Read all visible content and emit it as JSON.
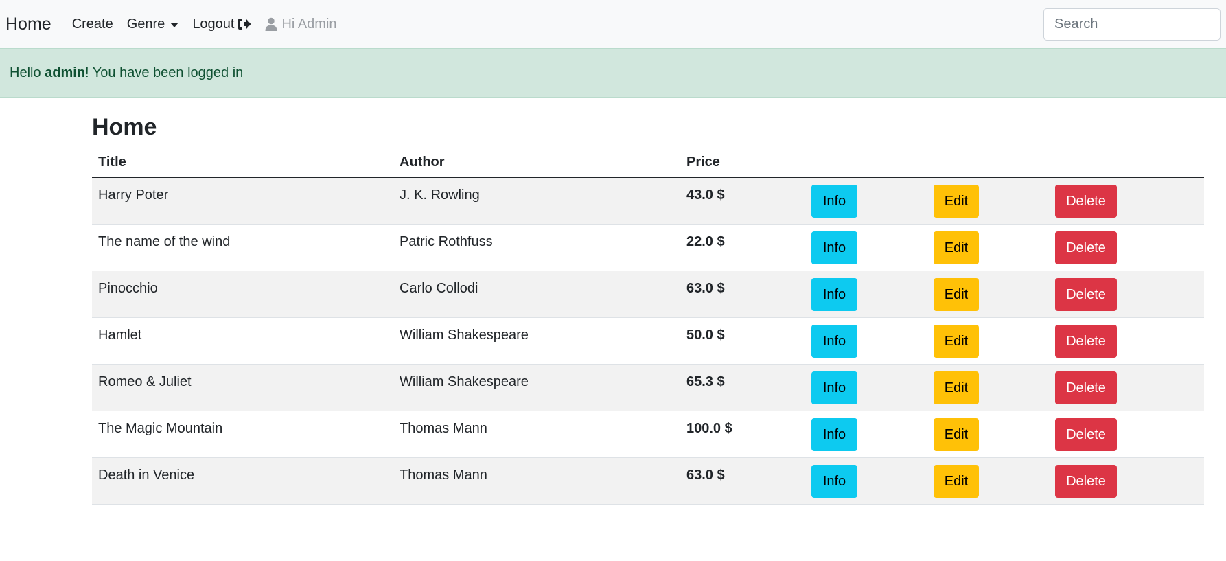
{
  "navbar": {
    "brand": "Home",
    "links": {
      "create": "Create",
      "genre": "Genre",
      "logout": "Logout",
      "user": "Hi Admin"
    },
    "search_placeholder": "Search",
    "icons": {
      "genre": "caret-down-icon",
      "logout": "sign-out-icon",
      "user": "user-icon"
    }
  },
  "alert": {
    "prefix": "Hello ",
    "username": "admin",
    "suffix": "! You have been logged in"
  },
  "main": {
    "title": "Home",
    "columns": {
      "title": "Title",
      "author": "Author",
      "price": "Price"
    },
    "buttons": {
      "info": "Info",
      "edit": "Edit",
      "delete": "Delete"
    },
    "rows": [
      {
        "title": "Harry Poter",
        "author": "J. K. Rowling",
        "price": "43.0 $"
      },
      {
        "title": "The name of the wind",
        "author": "Patric Rothfuss",
        "price": "22.0 $"
      },
      {
        "title": "Pinocchio",
        "author": "Carlo Collodi",
        "price": "63.0 $"
      },
      {
        "title": "Hamlet",
        "author": "William Shakespeare",
        "price": "50.0 $"
      },
      {
        "title": "Romeo & Juliet",
        "author": "William Shakespeare",
        "price": "65.3 $"
      },
      {
        "title": "The Magic Mountain",
        "author": "Thomas Mann",
        "price": "100.0 $"
      },
      {
        "title": "Death in Venice",
        "author": "Thomas Mann",
        "price": "63.0 $"
      }
    ]
  },
  "colors": {
    "navbar_bg": "#f8f9fa",
    "alert_bg": "#d1e7dd",
    "alert_text": "#0f5132",
    "info": "#0dcaf0",
    "edit": "#ffc107",
    "delete": "#dc3545",
    "striped_row": "#f2f2f2"
  }
}
